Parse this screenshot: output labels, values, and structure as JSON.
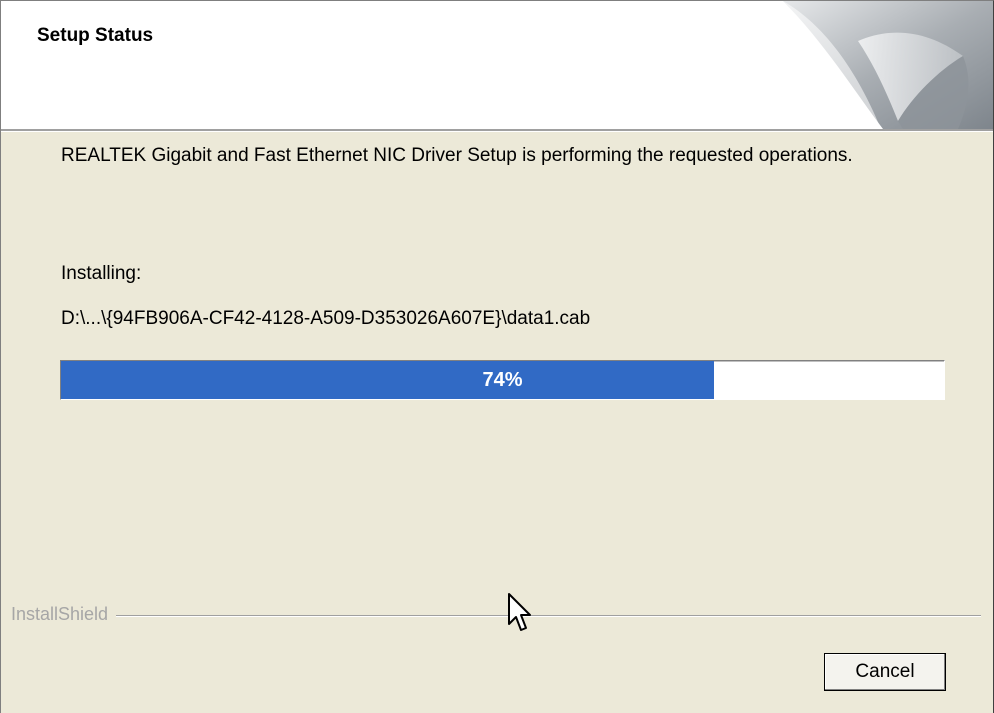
{
  "header": {
    "title": "Setup Status"
  },
  "main": {
    "description": "REALTEK Gigabit and Fast Ethernet NIC Driver Setup is performing the requested operations.",
    "installing_label": "Installing:",
    "file_path": "D:\\...\\{94FB906A-CF42-4128-A509-D353026A607E}\\data1.cab",
    "progress": {
      "percent": 74,
      "label": "74%",
      "fill_color": "#316ac5"
    }
  },
  "footer": {
    "brand": "InstallShield",
    "cancel_label": "Cancel"
  },
  "colors": {
    "dialog_background": "#ece9d8",
    "header_background": "#ffffff",
    "brand_text": "#a6a6a6"
  },
  "icons": {
    "header_graphic": "installshield-page-curl-icon",
    "cursor": "mouse-pointer-icon"
  }
}
